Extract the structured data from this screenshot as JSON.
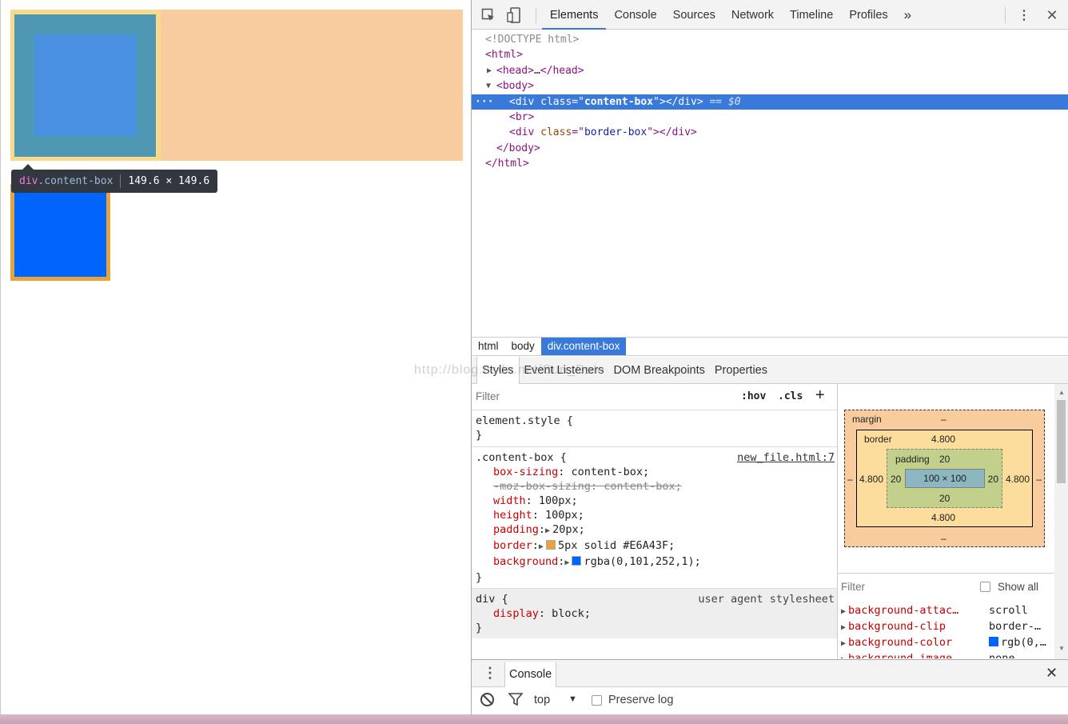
{
  "tooltip": {
    "tag": "div",
    "cls": ".content-box",
    "size": "149.6 × 149.6"
  },
  "devtools": {
    "tabs": [
      "Elements",
      "Console",
      "Sources",
      "Network",
      "Timeline",
      "Profiles"
    ],
    "more": "»",
    "tree": {
      "doctype": "<!DOCTYPE html>",
      "html_open": "<html>",
      "head_open": "<head>",
      "head_ellipsis": "…",
      "head_close": "</head>",
      "body_open": "<body>",
      "sel_dots": "···",
      "div1_open": "<div ",
      "attr_class": "class",
      "eq_quote": "=\"",
      "div1_val": "content-box",
      "close_quote": "\">",
      "div_close": "</div>",
      "sel_marker": "== $0",
      "br": "<br>",
      "div2_val": "border-box",
      "body_close": "</body>",
      "html_close": "</html>"
    },
    "breadcrumbs": [
      "html",
      "body",
      "div.content-box"
    ],
    "subtabs": [
      "Styles",
      "Event Listeners",
      "DOM Breakpoints",
      "Properties"
    ],
    "watermark": "http://blog.csdn.net/Sun_Dale",
    "styles": {
      "filter_placeholder": "Filter",
      "hov": ":hov",
      "cls": ".cls",
      "plus": "+",
      "element_style": "element.style {",
      "close_brace": "}",
      "rule1_selector": ".content-box {",
      "rule1_source": "new_file.html:7",
      "props": [
        {
          "name": "box-sizing",
          "value": "content-box;"
        },
        {
          "name": "-moz-box-sizing",
          "value": "content-box;"
        },
        {
          "name": "width",
          "value": "100px;"
        },
        {
          "name": "height",
          "value": "100px;"
        },
        {
          "name": "padding",
          "value": "20px;"
        },
        {
          "name": "border",
          "value": "5px solid #E6A43F;"
        },
        {
          "name": "background",
          "value": "rgba(0,101,252,1);"
        }
      ],
      "border_color": "#E6A43F",
      "bg_color": "#0065FC",
      "rule2_selector": "div {",
      "rule2_source": "user agent stylesheet",
      "rule2_prop": {
        "name": "display",
        "value": "block;"
      }
    },
    "boxmodel": {
      "margin_label": "margin",
      "margin_value": "–",
      "border_label": "border",
      "border_value": "4.800",
      "padding_label": "padding",
      "padding_value": "20",
      "content": "100 × 100",
      "side_margin": "–"
    },
    "computed": {
      "filter_placeholder": "Filter",
      "show_all": "Show all",
      "rows": [
        {
          "name": "background-attac…",
          "value": "scroll"
        },
        {
          "name": "background-clip",
          "value": "border-…"
        },
        {
          "name": "background-color",
          "value": "rgb(0,…"
        },
        {
          "name": "background-image",
          "value": "none"
        }
      ]
    },
    "console": {
      "title": "Console",
      "context": "top",
      "preserve_log": "Preserve log"
    }
  }
}
